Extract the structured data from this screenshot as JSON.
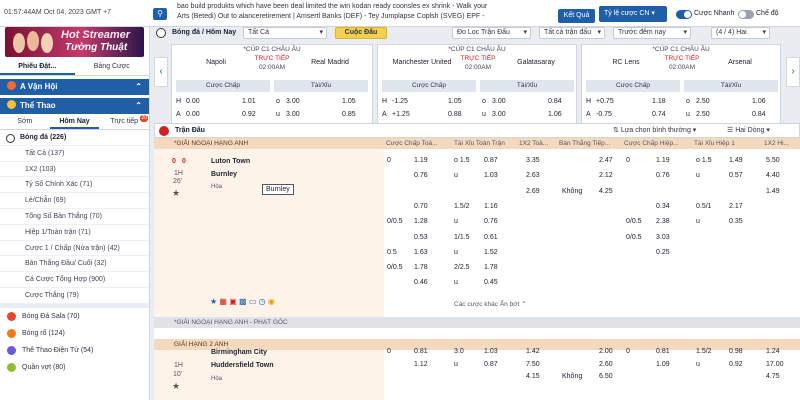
{
  "topbar": {
    "clock": "01:57:44AM Oct 04, 2023 GMT +7",
    "ticker_lines": [
      "bao build produkts which have been deal limited the win kodan ready coonsles ex shrink - Walk your",
      "Arts (Betedi) Out to alanceretirement | Amsertl Banks (DEF) - Tey Jumplapse Coplsh (SVEG) EPF -"
    ],
    "kq_button": "Kết Quả",
    "odds_select": "Tỷ lệ cược CN",
    "toggle1_label": "Cược Nhanh",
    "toggle2_label": "Chế độ"
  },
  "sidebar": {
    "banner_line1": "Hot Streamer",
    "banner_line2": "Tường Thuật",
    "tabs": [
      "Phiếu Đặt...",
      "Bảng Cược"
    ],
    "casino": "A Vận Hội",
    "sports": "Thể Thao",
    "subtabs": [
      "Sớm",
      "Hôm Nay",
      "Trực tiếp"
    ],
    "live_count": "20",
    "football": "Bóng đá (226)",
    "items": [
      "Tất Cả (137)",
      "1X2 (103)",
      "Tỷ Số Chính Xác (71)",
      "Lẻ/Chẵn (69)",
      "Tổng Số Bàn Thắng (70)",
      "Hiệp 1/Toàn trận (71)",
      "Cược 1 / Chấp (Nửa trận) (42)",
      "Bàn Thắng Đầu/ Cuối (32)",
      "Cá Cược Tổng Hợp (900)",
      "Cược Thắng (79)"
    ],
    "other_sports": [
      "Bóng Đá Sala (70)",
      "Bóng rổ (124)",
      "Thể Thao Điện Tử (54)",
      "Quần vợt (80)"
    ],
    "other_sport_colors": [
      "#e0472c",
      "#ee7b1a",
      "#6b5bd6",
      "#8fbd2f"
    ]
  },
  "filter": {
    "breadcrumb": "Bóng đá / Hôm Nay",
    "all": "Tất Cả",
    "top_button": "Cuộc Đấu",
    "match_filter": "Đo Lọc Trận Đấu",
    "all_matches": "Tất cả trận đấu",
    "time_sort": "Trước đêm nay",
    "pages": "(4 / 4) Hai"
  },
  "cards": [
    {
      "league": "*CÚP C1 CHÂU ÂU",
      "home": "Napoli",
      "away": "Real Madrid",
      "live": "TRỰC TIẾP",
      "time": "02:00AM",
      "h1": "Cược Chấp",
      "h2": "Tài/Xỉu",
      "rows": [
        [
          "H",
          "0.00",
          "1.01",
          "o",
          "3.00",
          "1.05"
        ],
        [
          "A",
          "0.00",
          "0.92",
          "u",
          "3.00",
          "0.85"
        ]
      ]
    },
    {
      "league": "*CÚP C1 CHÂU ÂU",
      "home": "Manchester United",
      "away": "Galatasaray",
      "live": "TRỰC TIẾP",
      "time": "02:00AM",
      "h1": "Cược Chấp",
      "h2": "Tài/Xỉu",
      "rows": [
        [
          "H",
          "-1.25",
          "1.05",
          "o",
          "3.00",
          "0.84"
        ],
        [
          "A",
          "+1.25",
          "0.88",
          "u",
          "3.00",
          "1.06"
        ]
      ]
    },
    {
      "league": "*CÚP C1 CHÂU ÂU",
      "home": "RC Lens",
      "away": "Arsenal",
      "live": "TRỰC TIẾP",
      "time": "02:00AM",
      "h1": "Cược Chấp",
      "h2": "Tài/Xỉu",
      "rows": [
        [
          "H",
          "+0.75",
          "1.18",
          "o",
          "2.50",
          "1.06"
        ],
        [
          "A",
          "-0.75",
          "0.74",
          "u",
          "2.50",
          "0.84"
        ]
      ]
    }
  ],
  "table": {
    "live_title": "Trận Đấu",
    "sort_label": "Lựa chọn bình thường",
    "double_label": "Hai Dòng",
    "league1": "*GIẢI NGOẠI HẠNG ANH",
    "league_hk": "*GIẢI NGOẠI HẠNG ANH - PHẠT GÓC",
    "league2": "GIẢI HẠNG 2 ANH",
    "headers": [
      "Cược Chấp Toà...",
      "Tài Xỉu Toàn Trận",
      "1X2 Toà...",
      "Bàn Thắng Tiếp...",
      "Cược Chấp Hiệp...",
      "Tài Xỉu Hiệp 1",
      "1X2 Hi..."
    ],
    "match1": {
      "score_h": "0",
      "score_a": "0",
      "period": "1H",
      "minute": "26'",
      "home": "Luton Town",
      "away": "Burnley",
      "draw": "Hòa",
      "tooltip": "Burnley",
      "more": "Các cược khác Ẩn bớt"
    },
    "match1_rows": [
      [
        "0",
        "1.19",
        "o 1.5",
        "0.87",
        "3.35",
        "",
        "2.47",
        "0",
        "1.19",
        "o 1.5",
        "1.49",
        "5.50"
      ],
      [
        "",
        "0.76",
        "u",
        "1.03",
        "2.63",
        "",
        "2.12",
        "",
        "0.76",
        "u",
        "0.57",
        "4.40"
      ],
      [
        "",
        "",
        "",
        "",
        "2.69",
        "Không",
        "4.25",
        "",
        "",
        "",
        "",
        "1.49"
      ],
      [
        "",
        "0.70",
        "1.5/2",
        "1.16",
        "",
        "",
        "",
        "",
        "0.34",
        "0.5/1",
        "2.17",
        ""
      ],
      [
        "0/0.5",
        "1.28",
        "u",
        "0.76",
        "",
        "",
        "",
        "0/0.5",
        "2.38",
        "u",
        "0.35",
        ""
      ],
      [
        "",
        "0.53",
        "1/1.5",
        "0.61",
        "",
        "",
        "",
        "0/0.5",
        "3.03",
        "",
        "",
        ""
      ],
      [
        "0.5",
        "1.63",
        "u",
        "1.52",
        "",
        "",
        "",
        "",
        "0.25",
        "",
        "",
        ""
      ],
      [
        "0/0.5",
        "1.78",
        "2/2.5",
        "1.78",
        "",
        "",
        "",
        "",
        "",
        "",
        "",
        ""
      ],
      [
        "",
        "0.46",
        "u",
        "0.45",
        "",
        "",
        "",
        "",
        "",
        "",
        "",
        ""
      ]
    ],
    "match2": {
      "period": "1H",
      "minute": "10'",
      "home": "Birmingham City",
      "away": "Huddersfield Town",
      "draw": "Hòa"
    },
    "match2_rows": [
      [
        "0",
        "0.81",
        "3.0",
        "1.03",
        "1.42",
        "",
        "2.00",
        "0",
        "0.81",
        "1.5/2",
        "0.98",
        "1.24"
      ],
      [
        "",
        "1.12",
        "u",
        "0.87",
        "7.50",
        "",
        "2.60",
        "",
        "1.09",
        "u",
        "0.92",
        "17.00"
      ],
      [
        "",
        "",
        "",
        "",
        "4.15",
        "Không",
        "6.50",
        "",
        "",
        "",
        "",
        "4.75"
      ]
    ]
  },
  "colors": {
    "brand": "#1f5fa8",
    "league_band": "#f4d9bf",
    "live_red": "#d21f1f"
  }
}
